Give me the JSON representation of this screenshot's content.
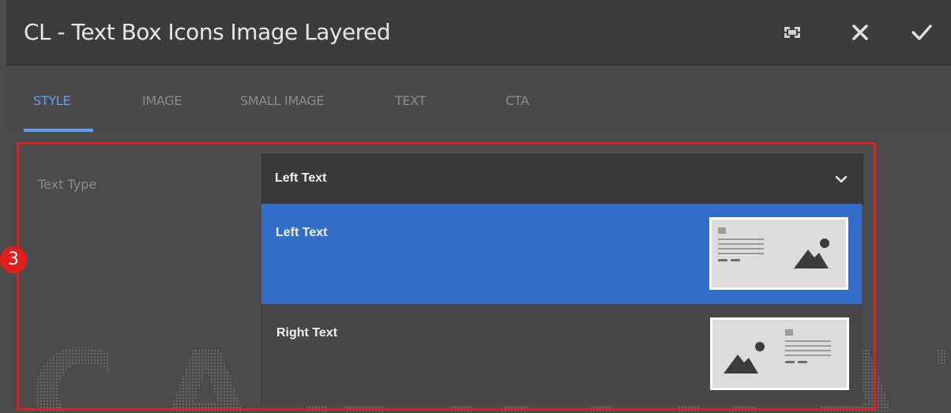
{
  "dialog": {
    "title": "CL - Text Box Icons Image Layered",
    "toolbar": {
      "fullscreen_icon": "fullscreen-icon",
      "close_icon": "close-icon",
      "confirm_icon": "checkmark-icon"
    }
  },
  "tabs": [
    {
      "label": "STYLE",
      "active": true
    },
    {
      "label": "IMAGE",
      "active": false
    },
    {
      "label": "SMALL IMAGE",
      "active": false
    },
    {
      "label": "TEXT",
      "active": false
    },
    {
      "label": "CTA",
      "active": false
    }
  ],
  "form": {
    "text_type": {
      "label": "Text Type",
      "selected_value": "Left Text",
      "options": [
        {
          "label": "Left Text",
          "selected": true,
          "thumbnail": "left-text-layout-icon"
        },
        {
          "label": "Right Text",
          "selected": false,
          "thumbnail": "right-text-layout-icon"
        }
      ]
    }
  },
  "annotation": {
    "step_number": "3",
    "color": "#e01e1e"
  },
  "colors": {
    "accent": "#5aa0ef",
    "selected_option": "#326ec8",
    "titlebar": "#3c3c3c",
    "background": "#4b4b4b"
  }
}
